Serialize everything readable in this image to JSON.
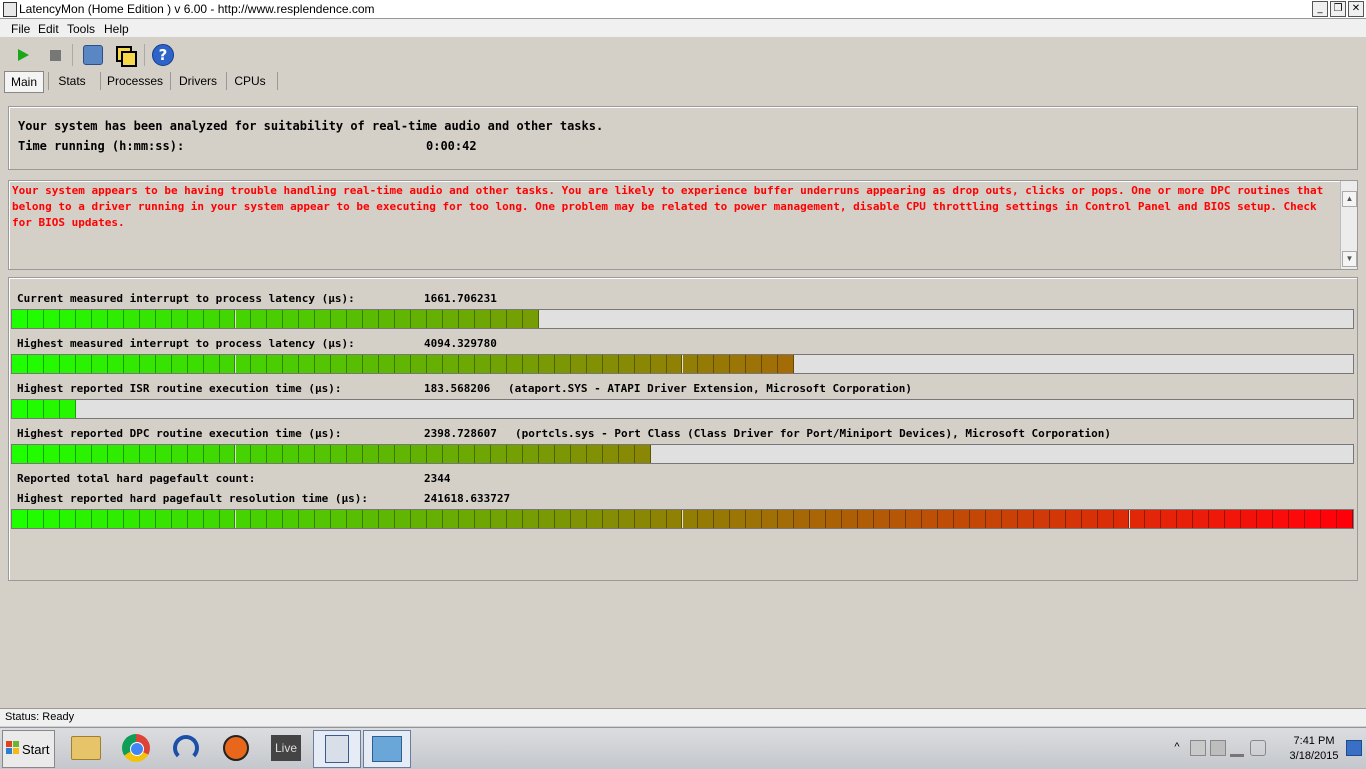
{
  "window": {
    "title": "LatencyMon  (Home Edition )  v 6.00 - http://www.resplendence.com",
    "minimize": "_",
    "restore": "❐",
    "close": "✕"
  },
  "menu": [
    "File",
    "Edit",
    "Tools",
    "Help"
  ],
  "toolbar": {
    "icons": [
      "play-icon",
      "stop-icon",
      "wrench-icon",
      "windows-icon",
      "help-icon"
    ],
    "help_glyph": "?"
  },
  "tabs": [
    "Main",
    "Stats",
    "Processes",
    "Drivers",
    "CPUs"
  ],
  "summary": {
    "line1": "Your system has been analyzed for suitability of real-time audio and other tasks.",
    "time_label": "Time running (h:mm:ss):",
    "time_value": "0:00:42"
  },
  "warning": {
    "text": "Your system appears to be having trouble handling real-time audio and other tasks. You are likely to experience buffer underruns appearing as drop outs, clicks or pops. One or more DPC routines that belong to a driver running in your system appear to be executing for too long. One problem may be related to power management, disable CPU throttling settings in Control Panel and BIOS setup. Check for BIOS updates.",
    "color": "#ff0000",
    "scroll_up": "▲",
    "scroll_down": "▼"
  },
  "metrics": [
    {
      "label": "Current measured interrupt to process latency (µs):",
      "value": "1661.706231",
      "detail": "",
      "segments": 33
    },
    {
      "label": "Highest measured interrupt to process latency (µs):",
      "value": "4094.329780",
      "detail": "",
      "segments": 49
    },
    {
      "label": "Highest reported ISR routine execution time (µs):",
      "value": "183.568206",
      "detail": "(ataport.SYS - ATAPI Driver Extension, Microsoft Corporation)",
      "segments": 4
    },
    {
      "label": "Highest reported DPC routine execution time (µs):",
      "value": "2398.728607",
      "detail": "(portcls.sys - Port Class (Class Driver for Port/Miniport Devices), Microsoft Corporation)",
      "segments": 40
    },
    {
      "label": "Reported total hard pagefault count:",
      "value": "2344",
      "detail": ""
    },
    {
      "label": "Highest reported hard pagefault resolution time (µs):",
      "value": "241618.633727",
      "detail": "",
      "segments": 84
    }
  ],
  "meter_total_segments": 84,
  "status": "Status: Ready",
  "taskbar": {
    "start": "Start",
    "apps": [
      "folder-icon",
      "chrome-icon",
      "headphones-icon",
      "reason-icon",
      "live-icon",
      "latencymon-icon",
      "monitor-icon"
    ],
    "live_label": "Live",
    "tray_expand": "^",
    "time": "7:41 PM",
    "date": "3/18/2015"
  }
}
